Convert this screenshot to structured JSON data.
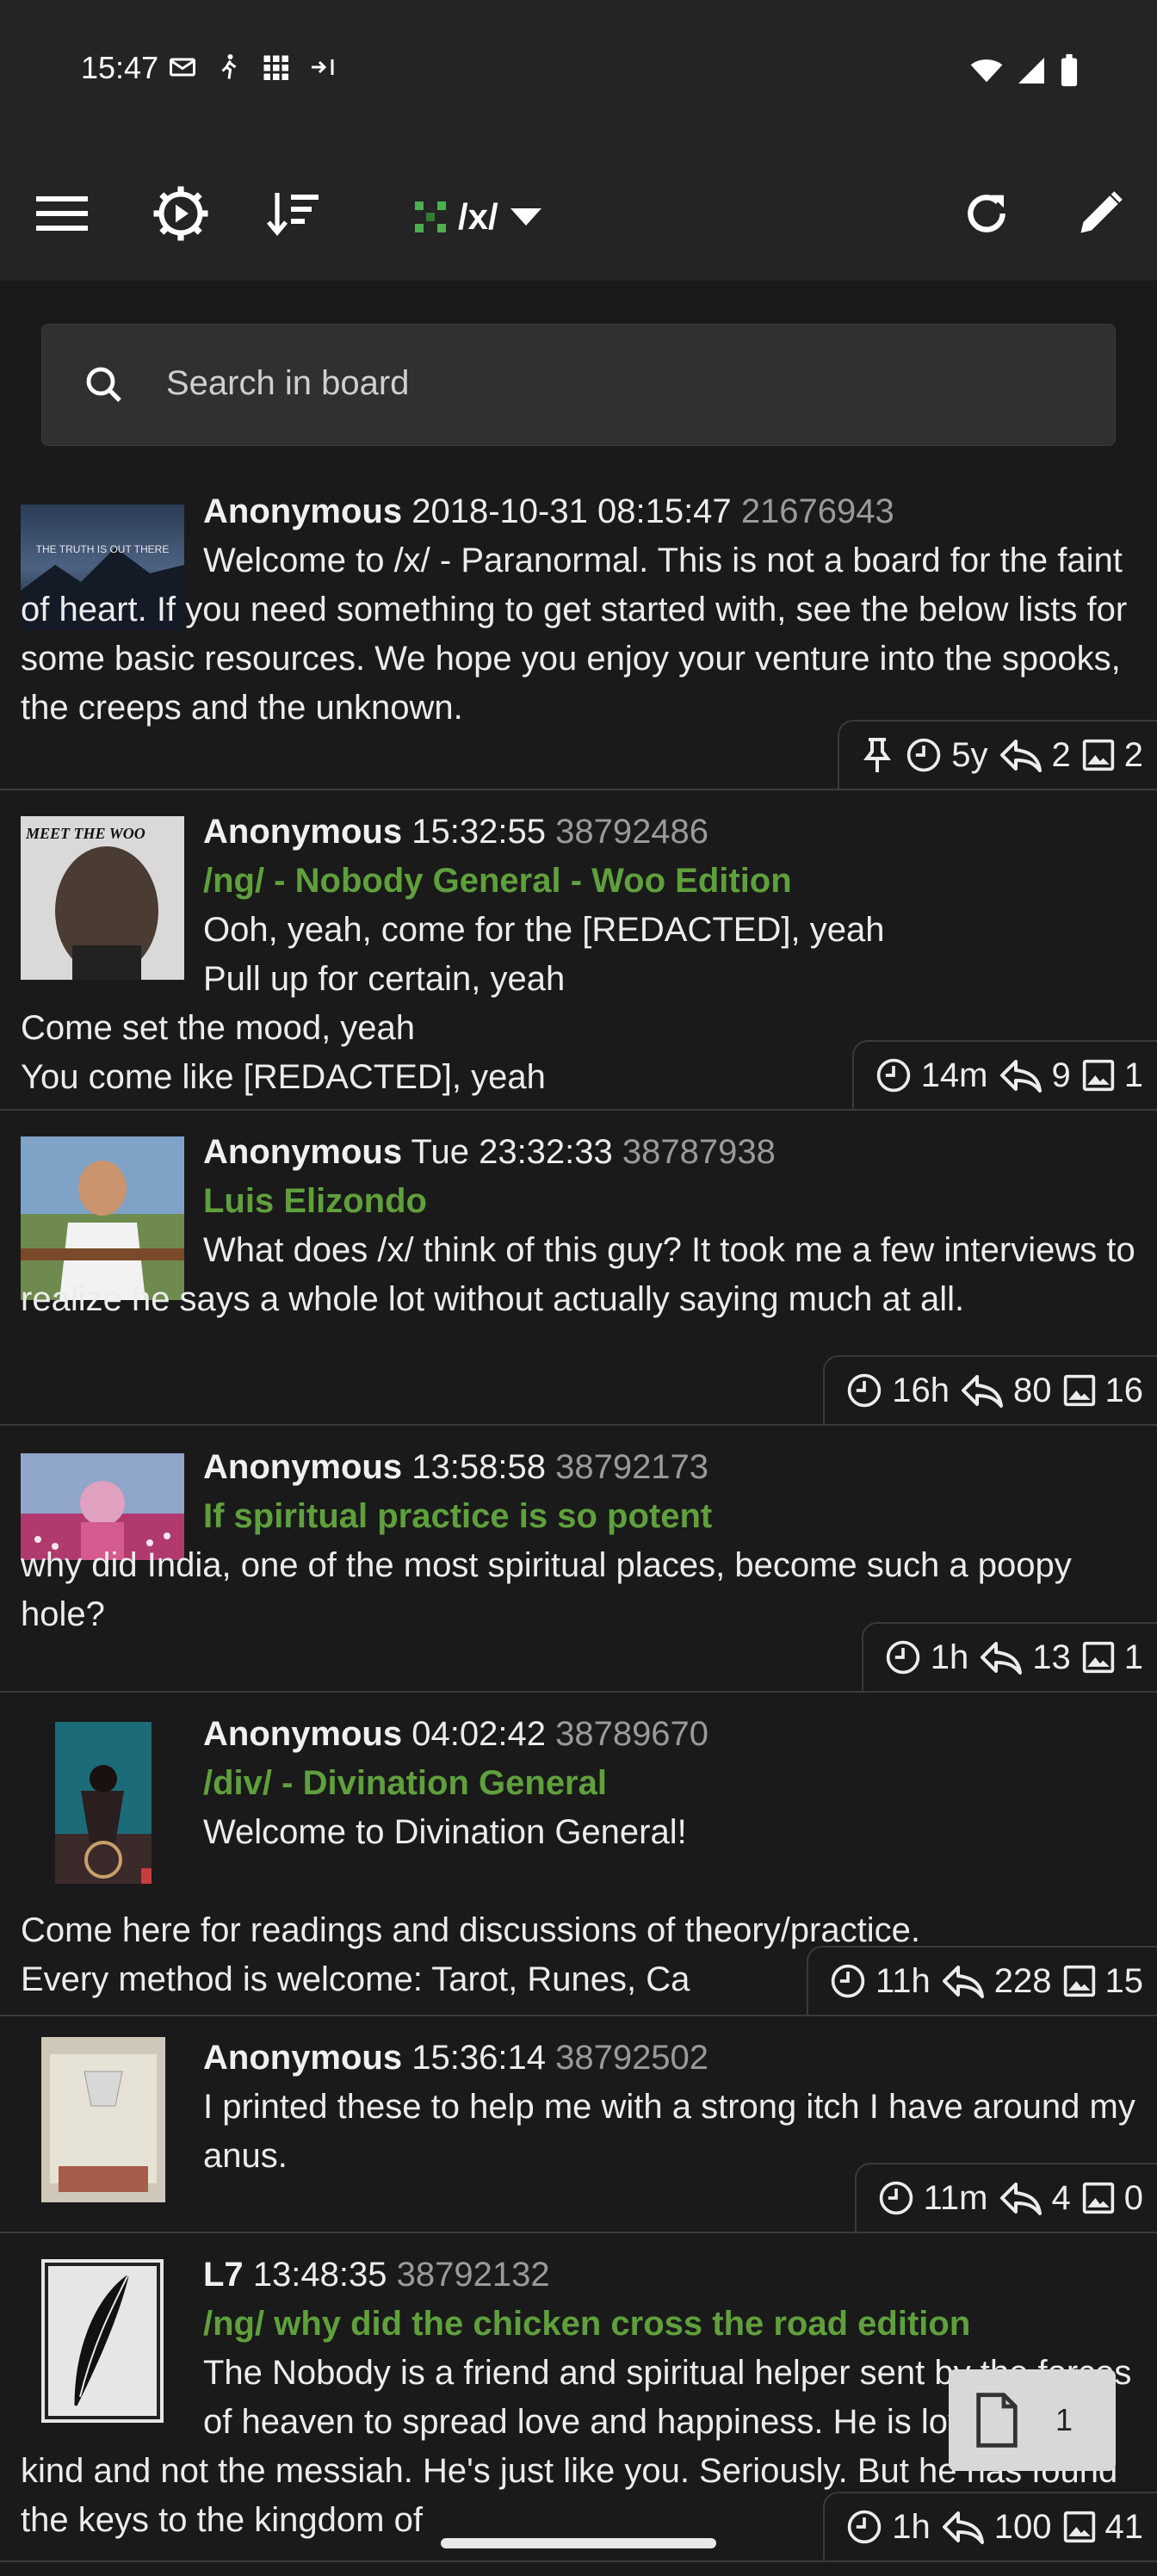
{
  "status_bar": {
    "time": "15:47",
    "left_icons": [
      "mail-icon",
      "walking-icon",
      "grid-icon",
      "data-arrows-icon"
    ],
    "right_icons": [
      "wifi-icon",
      "signal-icon",
      "battery-icon"
    ]
  },
  "toolbar": {
    "menu_icon": "hamburger-menu-icon",
    "settings_icon": "gear-icon",
    "sort_icon": "sort-icon",
    "board": "/x/",
    "refresh_icon": "refresh-icon",
    "compose_icon": "pencil-icon"
  },
  "search": {
    "placeholder": "Search in board"
  },
  "threads": [
    {
      "poster": "Anonymous",
      "date": "2018-10-31 08:15:47",
      "post_no": "21676943",
      "subject": "",
      "comment": "Welcome to /x/ - Paranormal. This is not a board for the faint of heart. If you need something to get started with, see the below lists for some basic resources. We hope you enjoy your venture into the spooks, the creeps and the unknown.",
      "pinned": true,
      "age": "5y",
      "replies": "2",
      "images": "2",
      "thumb_text": "THE TRUTH IS OUT THERE"
    },
    {
      "poster": "Anonymous",
      "date": "15:32:55",
      "post_no": "38792486",
      "subject": "/ng/ - Nobody General - Woo Edition",
      "comment": "Ooh, yeah, come for the [REDACTED], yeah\nPull up for certain, yeah\nCome set the mood, yeah\nYou come like [REDACTED], yeah",
      "pinned": false,
      "age": "14m",
      "replies": "9",
      "images": "1",
      "thumb_text": "MEET THE WOO"
    },
    {
      "poster": "Anonymous",
      "date": "Tue 23:32:33",
      "post_no": "38787938",
      "subject": "Luis Elizondo",
      "comment": "What does /x/ think of this guy? It took me a few interviews to realize he says a whole lot without actually saying much at all.",
      "pinned": false,
      "age": "16h",
      "replies": "80",
      "images": "16",
      "thumb_text": ""
    },
    {
      "poster": "Anonymous",
      "date": "13:58:58",
      "post_no": "38792173",
      "subject": "If spiritual practice is so potent",
      "comment": "why did India, one of the most spiritual places, become such a poopy hole?",
      "pinned": false,
      "age": "1h",
      "replies": "13",
      "images": "1",
      "thumb_text": ""
    },
    {
      "poster": "Anonymous",
      "date": "04:02:42",
      "post_no": "38789670",
      "subject": "/div/ - Divination General",
      "comment": "Welcome to Divination General!\n\nCome here for readings and discussions of theory/practice.\nEvery method is welcome: Tarot, Runes, Ca",
      "pinned": false,
      "age": "11h",
      "replies": "228",
      "images": "15",
      "thumb_text": ""
    },
    {
      "poster": "Anonymous",
      "date": "15:36:14",
      "post_no": "38792502",
      "subject": "",
      "comment": "I printed these to help me with a strong itch I have around my anus.",
      "pinned": false,
      "age": "11m",
      "replies": "4",
      "images": "0",
      "thumb_text": ""
    },
    {
      "poster": "L7",
      "date": "13:48:35",
      "post_no": "38792132",
      "subject": "/ng/ why did the chicken cross the road edition",
      "comment": "The Nobody is a friend and spiritual helper sent by the forces of heaven to spread love and happiness. He is loving and kind and not the messiah. He's just like you. Seriously. But he has found the keys to the kingdom of",
      "pinned": false,
      "age": "1h",
      "replies": "100",
      "images": "41",
      "thumb_text": ""
    }
  ],
  "page_indicator": {
    "value": "1",
    "icon": "document-icon"
  },
  "colors": {
    "background": "#1a1a1a",
    "toolbar": "#242424",
    "subject": "#5fa03c",
    "post_no": "#9a9a9a",
    "board_dots": "#4caf50"
  }
}
